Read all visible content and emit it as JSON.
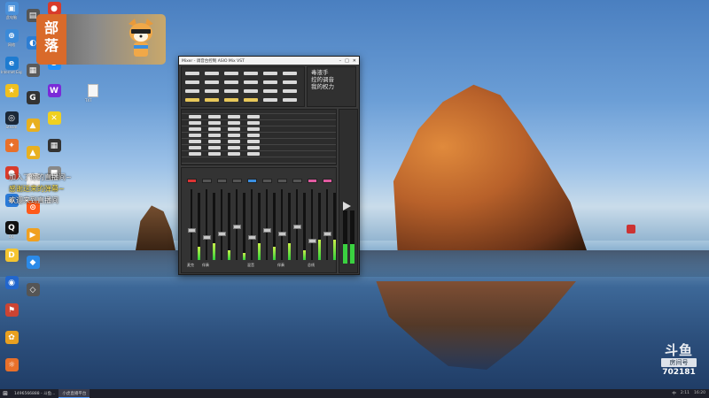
{
  "tribe_badge": {
    "text_line1": "部",
    "text_line2": "落"
  },
  "danmaku": [
    {
      "user": "",
      "text": "加入了你的直播间~",
      "highlight": false
    },
    {
      "user": "",
      "text": "感谢送来的弹幕~",
      "highlight": true
    },
    {
      "user": "",
      "text": "欢迎来到直播间",
      "highlight": false
    }
  ],
  "desktop_icons": [
    {
      "label": "此电脑",
      "color": "#4a90d9",
      "glyph": "▣"
    },
    {
      "label": "网络",
      "color": "#3b8ad8",
      "glyph": "⊕"
    },
    {
      "label": "Internet Explorer",
      "color": "#1e7bd0",
      "glyph": "e"
    },
    {
      "label": "",
      "color": "#f0c020",
      "glyph": "★"
    },
    {
      "label": "Steam",
      "color": "#1b2838",
      "glyph": "◎"
    },
    {
      "label": "",
      "color": "#e8702a",
      "glyph": "✦"
    },
    {
      "label": "",
      "color": "#d83b2b",
      "glyph": "●"
    },
    {
      "label": "",
      "color": "#2b7bd8",
      "glyph": "◆"
    },
    {
      "label": "QQ",
      "color": "#111",
      "glyph": "Q"
    },
    {
      "label": "",
      "color": "#f4c430",
      "glyph": "D"
    },
    {
      "label": "",
      "color": "#2266cc",
      "glyph": "◉"
    },
    {
      "label": "",
      "color": "#c43",
      "glyph": "⚑"
    },
    {
      "label": "",
      "color": "#e8a020",
      "glyph": "✿"
    },
    {
      "label": "",
      "color": "#e8702a",
      "glyph": "☼"
    }
  ],
  "desktop_icons_col2": [
    {
      "label": "",
      "color": "#555",
      "glyph": "▤"
    },
    {
      "label": "",
      "color": "#2d7dd2",
      "glyph": "◐"
    },
    {
      "label": "",
      "color": "#5a5a5a",
      "glyph": "▦"
    },
    {
      "label": "",
      "color": "#333",
      "glyph": "G"
    },
    {
      "label": "",
      "color": "#e8b020",
      "glyph": "▲"
    },
    {
      "label": "",
      "color": "#e8b020",
      "glyph": "▲"
    },
    {
      "label": "",
      "color": "#f0f0f0",
      "glyph": "◈"
    },
    {
      "label": "",
      "color": "#ff5a1a",
      "glyph": "⊙"
    },
    {
      "label": "",
      "color": "#f0a020",
      "glyph": "▶"
    },
    {
      "label": "",
      "color": "#2b8ae8",
      "glyph": "◆"
    },
    {
      "label": "",
      "color": "#555",
      "glyph": "◇"
    }
  ],
  "desktop_icons_col3": [
    {
      "label": "",
      "color": "#d83b2b",
      "glyph": "●"
    },
    {
      "label": "",
      "color": "#2b6ed8",
      "glyph": "▤"
    },
    {
      "label": "",
      "color": "#1e90ff",
      "glyph": "S"
    },
    {
      "label": "",
      "color": "#7a2bd8",
      "glyph": "W"
    },
    {
      "label": "",
      "color": "#f0d020",
      "glyph": "✕"
    },
    {
      "label": "",
      "color": "#333",
      "glyph": "▦"
    },
    {
      "label": "",
      "color": "#888",
      "glyph": "■"
    }
  ],
  "file_icon_label": "TXT",
  "mixer": {
    "title": "Mixer - 调音台控制 ASIO Mix VST",
    "side_note": [
      "毒液手",
      "控的调音",
      "我的权力"
    ],
    "strips": [
      {
        "label": "麦克",
        "fader": 0.45,
        "level": 0.2,
        "color": "red"
      },
      {
        "label": "伴奏",
        "fader": 0.35,
        "level": 0.25,
        "color": ""
      },
      {
        "label": "",
        "fader": 0.4,
        "level": 0.15,
        "color": ""
      },
      {
        "label": "",
        "fader": 0.5,
        "level": 0.1,
        "color": ""
      },
      {
        "label": "混音",
        "fader": 0.35,
        "level": 0.25,
        "color": "blue"
      },
      {
        "label": "",
        "fader": 0.45,
        "level": 0.2,
        "color": ""
      },
      {
        "label": "伴奏",
        "fader": 0.4,
        "level": 0.25,
        "color": ""
      },
      {
        "label": "",
        "fader": 0.5,
        "level": 0.15,
        "color": ""
      },
      {
        "label": "总线",
        "fader": 0.3,
        "level": 0.3,
        "color": "pink"
      },
      {
        "label": "",
        "fader": 0.4,
        "level": 0.3,
        "color": "pink"
      }
    ]
  },
  "taskbar": {
    "items": [
      "1496566888 - 斗鱼...",
      "小虎直播平台"
    ],
    "tray": [
      "中",
      "2:11",
      "16:20"
    ]
  },
  "douyu": {
    "logo": "斗鱼",
    "room_label": "房间号",
    "room_number": "702181"
  },
  "right_icon_label": "",
  "colors": {
    "accent": "#d96a2a",
    "meter": "#33d13a",
    "taskbar": "#1e1f29"
  }
}
